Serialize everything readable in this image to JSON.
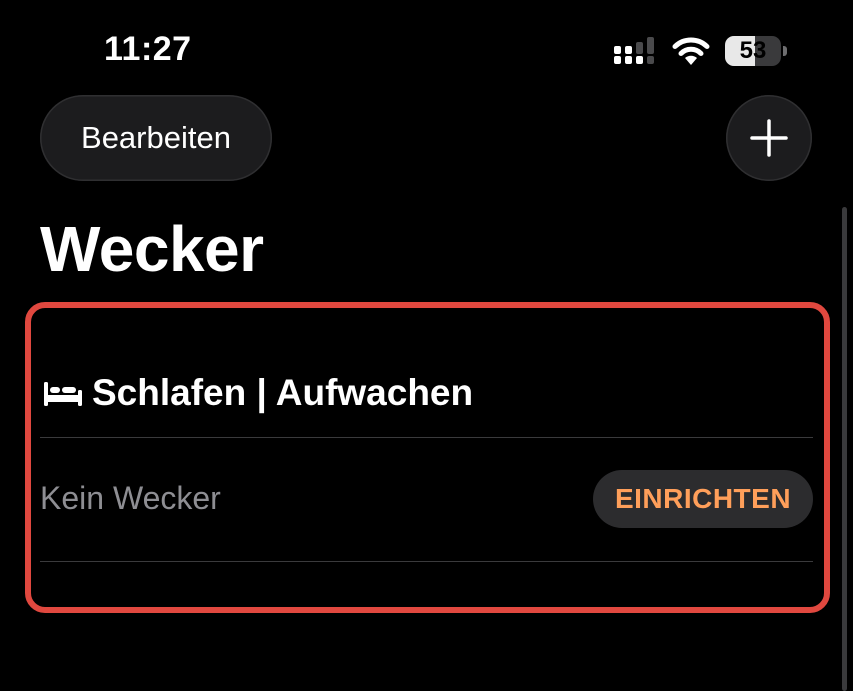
{
  "status_bar": {
    "time": "11:27",
    "battery_percent": "53",
    "battery_level": 0.53,
    "signal_icon": "cellular-signal-icon",
    "wifi_icon": "wifi-icon"
  },
  "nav": {
    "edit_label": "Bearbeiten",
    "add_icon": "plus-icon"
  },
  "page": {
    "title": "Wecker"
  },
  "sleep_section": {
    "icon": "bed-icon",
    "title": "Schlafen | Aufwachen",
    "status_text": "Kein Wecker",
    "setup_label": "EINRICHTEN"
  },
  "colors": {
    "background": "#000000",
    "accent_orange": "#ff9f5a",
    "highlight_red": "#e0483f",
    "button_fill": "#1c1c1e",
    "secondary_text": "#8e8e93"
  }
}
